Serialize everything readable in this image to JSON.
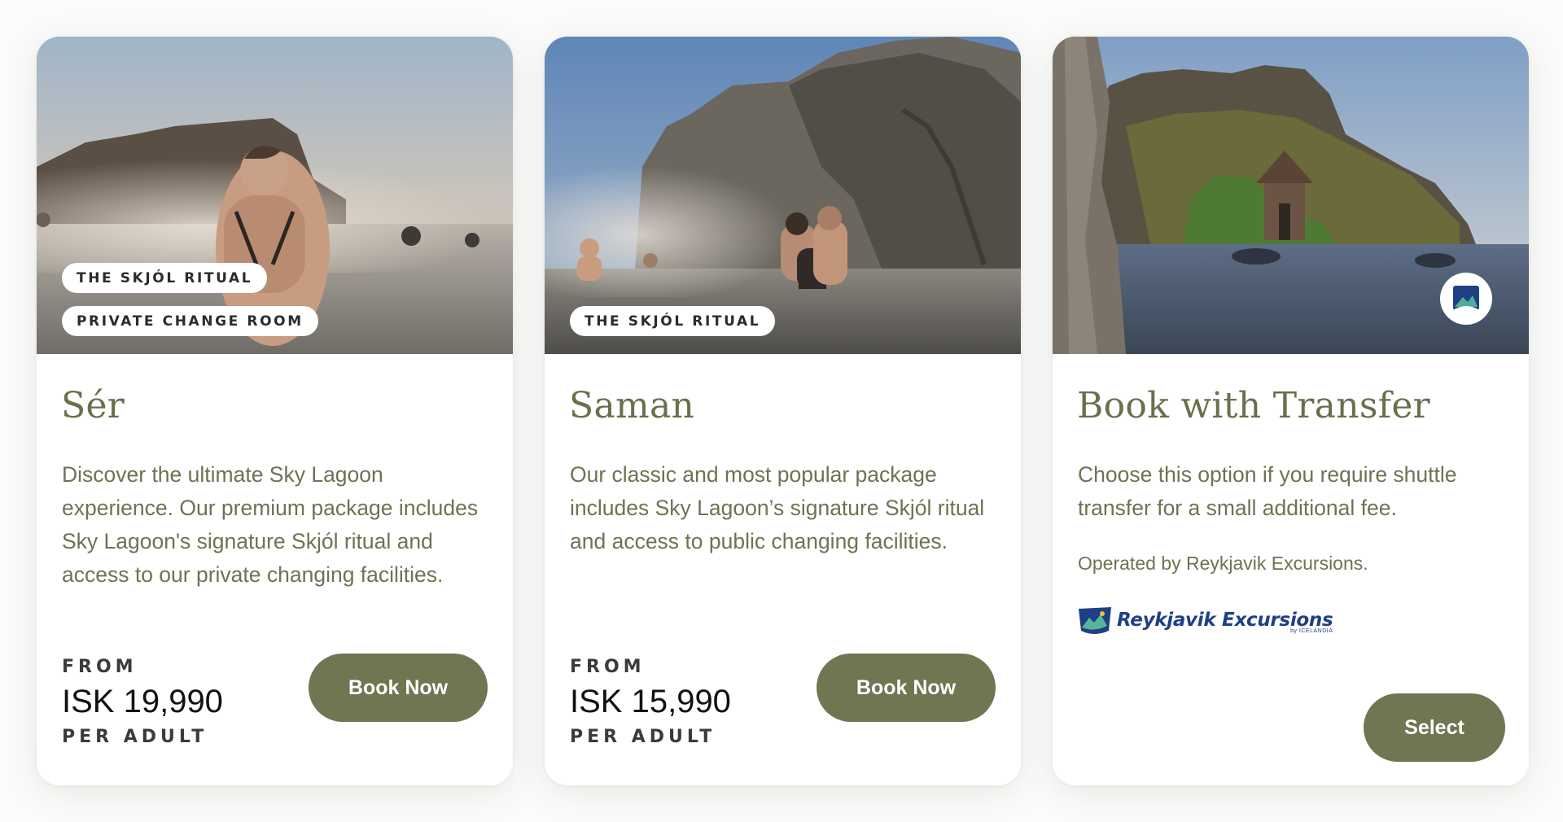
{
  "cards": [
    {
      "tags": [
        "THE SKJÓL RITUAL",
        "PRIVATE CHANGE ROOM"
      ],
      "title": "Sér",
      "description": "Discover the ultimate Sky Lagoon experience. Our premium package includes Sky Lagoon's signature Skjól ritual and access to our private changing facilities.",
      "price": {
        "from": "FROM",
        "amount": "ISK 19,990",
        "per": "PER ADULT"
      },
      "button": "Book Now"
    },
    {
      "tags": [
        "THE SKJÓL RITUAL"
      ],
      "title": "Saman",
      "description": "Our classic and most popular package includes Sky Lagoon’s signature Skjól ritual and access to public changing facilities.",
      "price": {
        "from": "FROM",
        "amount": "ISK 15,990",
        "per": "PER ADULT"
      },
      "button": "Book Now"
    },
    {
      "title": "Book with Transfer",
      "description": "Choose this option if you require shuttle transfer for a small additional fee.",
      "note": "Operated by Reykjavik Excursions.",
      "logo": {
        "main": "Reykjavik Excursions",
        "sub": "by ICELANDIA",
        "icon": "reykjavik-excursions-logo-icon"
      },
      "badge_icon": "mountain-badge-icon",
      "button": "Select"
    }
  ],
  "colors": {
    "accent": "#707552",
    "title": "#68704c",
    "body_text": "#6e7352",
    "logo_blue": "#1f3f86"
  }
}
